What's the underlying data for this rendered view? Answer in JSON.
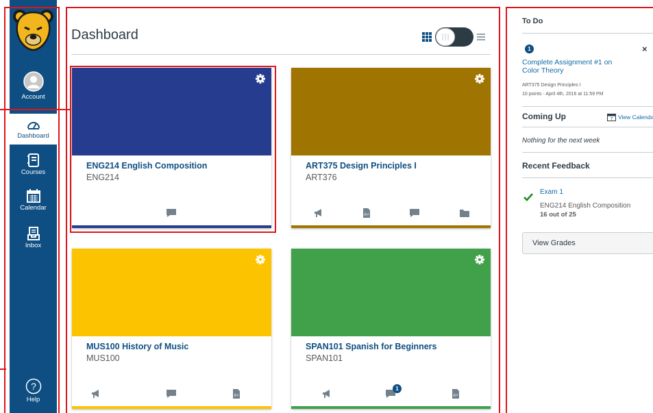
{
  "nav": {
    "items": [
      {
        "label": "Account",
        "icon": "account-icon"
      },
      {
        "label": "Dashboard",
        "icon": "dashboard-icon"
      },
      {
        "label": "Courses",
        "icon": "courses-icon"
      },
      {
        "label": "Calendar",
        "icon": "calendar-icon"
      },
      {
        "label": "Inbox",
        "icon": "inbox-icon"
      },
      {
        "label": "Help",
        "icon": "help-icon"
      }
    ],
    "active": "Dashboard"
  },
  "main": {
    "title": "Dashboard",
    "cards": [
      {
        "title": "ENG214 English Composition",
        "code": "ENG214",
        "color": "#263c8e",
        "actions": [
          "discussion-icon"
        ]
      },
      {
        "title": "ART375 Design Principles I",
        "code": "ART376",
        "color": "#a07400",
        "actions": [
          "announcement-icon",
          "assignment-icon",
          "discussion-icon",
          "files-icon"
        ]
      },
      {
        "title": "MUS100 History of Music",
        "code": "MUS100",
        "color": "#fcc400",
        "actions": [
          "announcement-icon",
          "discussion-icon",
          "assignment-icon"
        ]
      },
      {
        "title": "SPAN101 Spanish for Beginners",
        "code": "SPAN101",
        "color": "#41a04a",
        "actions": [
          "announcement-icon",
          "discussion-icon",
          "assignment-icon"
        ],
        "discussion_badge": "1"
      }
    ]
  },
  "sidebar": {
    "todo_heading": "To Do",
    "todo": {
      "badge": "1",
      "title_line1": "Complete Assignment #1 on",
      "title_line2": "Color Theory",
      "course": "ART375 Design Principles I",
      "meta": "10 points - April 4th, 2016 at 11:59 PM"
    },
    "coming_up_heading": "Coming Up",
    "view_calendar": "View Calendar",
    "coming_up_empty": "Nothing for the next week",
    "feedback_heading": "Recent Feedback",
    "feedback": {
      "title": "Exam 1",
      "course": "ENG214 English Composition",
      "score": "16 out of 25"
    },
    "view_grades": "View Grades"
  },
  "colors": {
    "nav_bg": "#0e4e82",
    "link": "#0e6aa6",
    "highlight": "#e0141b"
  }
}
